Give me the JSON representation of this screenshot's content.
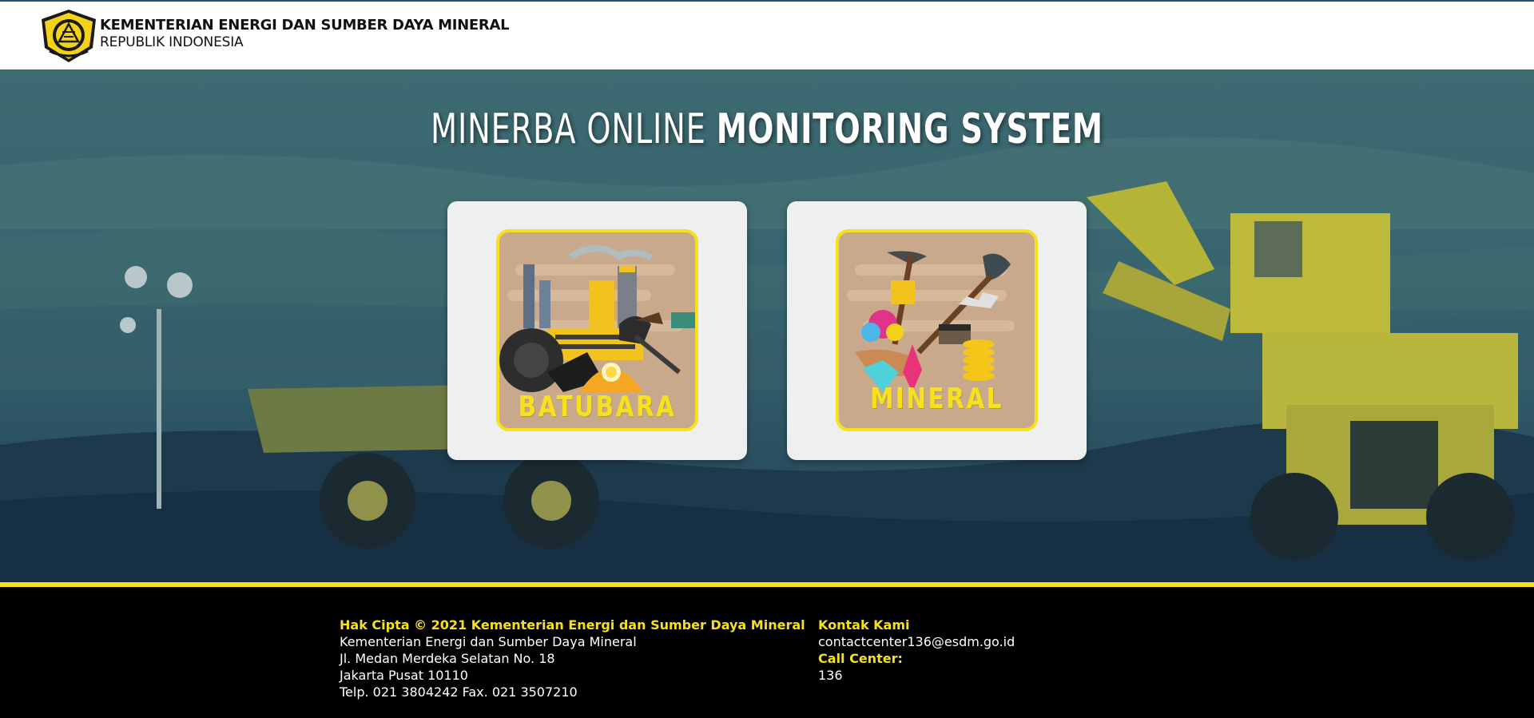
{
  "header": {
    "org_name": "KEMENTERIAN ENERGI DAN SUMBER DAYA MINERAL",
    "org_sub": "REPUBLIK INDONESIA",
    "logo_icon": "esdm-emblem-icon"
  },
  "hero": {
    "title_light": "MINERBA ONLINE",
    "title_bold": "MONITORING SYSTEM"
  },
  "cards": [
    {
      "label": "BATUBARA",
      "icon": "coal-mining-illustration-icon"
    },
    {
      "label": "MINERAL",
      "icon": "mineral-mining-illustration-icon"
    }
  ],
  "footer": {
    "copyright": "Hak Cipta © 2021 Kementerian Energi dan Sumber Daya Mineral",
    "address_lines": [
      "Kementerian Energi dan Sumber Daya Mineral",
      "Jl. Medan Merdeka Selatan No. 18",
      "Jakarta Pusat 10110",
      "Telp. 021 3804242 Fax. 021 3507210"
    ],
    "contact_heading": "Kontak Kami",
    "email": "contactcenter136@esdm.go.id",
    "call_center_heading": "Call Center:",
    "call_center_number": "136"
  },
  "colors": {
    "accent_yellow": "#f7e11a",
    "header_border": "#1e4f78",
    "footer_bg": "#000000"
  }
}
